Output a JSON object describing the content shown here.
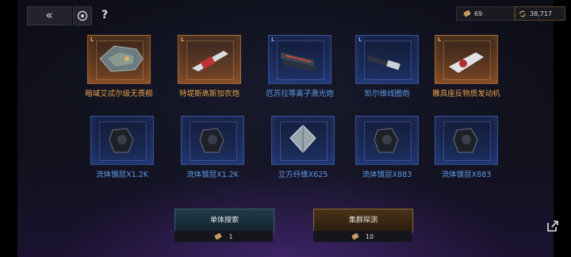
{
  "topbar": {
    "back_icon": "double-chevron-left-icon",
    "settings_icon": "target-gear-icon",
    "help_label": "?"
  },
  "resources": [
    {
      "icon": "bullet-token-icon",
      "value": "69"
    },
    {
      "icon": "refresh-currency-icon",
      "value": "38,717"
    }
  ],
  "rewards": [
    {
      "name": "暗域艾忒尔级无畏舰",
      "rarity": "L",
      "tier": "orange",
      "icon": "dreadnought-ship-icon"
    },
    {
      "name": "特堤斯高斯加农炮",
      "rarity": "L",
      "tier": "orange",
      "icon": "gauss-cannon-icon"
    },
    {
      "name": "厄苏拉等离子激光炮",
      "rarity": "L",
      "tier": "blue",
      "icon": "plasma-laser-icon"
    },
    {
      "name": "凯尔维线圈炮",
      "rarity": "L",
      "tier": "blue",
      "icon": "coil-gun-icon"
    },
    {
      "name": "雕具座反物质发动机",
      "rarity": "L",
      "tier": "orange",
      "icon": "antimatter-engine-icon"
    },
    {
      "name": "流体镀层X1.2K",
      "rarity": "",
      "tier": "blue",
      "icon": "fluid-coating-icon"
    },
    {
      "name": "流体镀层X1.2K",
      "rarity": "",
      "tier": "blue",
      "icon": "fluid-coating-icon"
    },
    {
      "name": "立方纤维X625",
      "rarity": "",
      "tier": "blue",
      "icon": "cubic-fiber-icon"
    },
    {
      "name": "流体镀层X883",
      "rarity": "",
      "tier": "blue",
      "icon": "fluid-coating-icon"
    },
    {
      "name": "流体镀层X883",
      "rarity": "",
      "tier": "blue",
      "icon": "fluid-coating-icon"
    }
  ],
  "actions": {
    "single_search_label": "单体搜索",
    "single_search_cost": "1",
    "cluster_probe_label": "集群探测",
    "cluster_probe_cost": "10",
    "cost_icon": "bullet-token-icon"
  },
  "share_icon": "external-link-icon",
  "colors": {
    "legend": "#e9a24c",
    "rare": "#5d9be8",
    "accent": "#8a6a3a"
  }
}
